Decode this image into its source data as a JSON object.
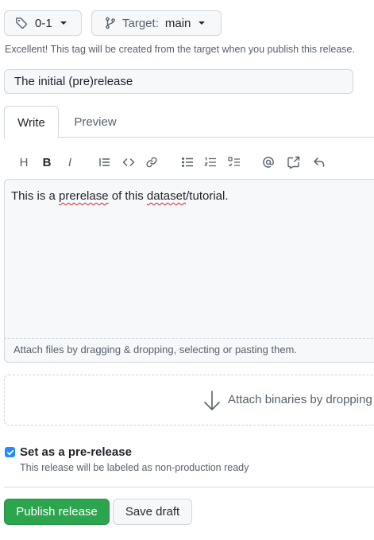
{
  "tag_selector": {
    "value": "0-1",
    "icon": "tag-icon"
  },
  "target_selector": {
    "prefix": "Target:",
    "value": "main",
    "icon": "git-branch-icon"
  },
  "tag_hint": "Excellent! This tag will be created from the target when you publish this release.",
  "release_title": {
    "value": "The initial (pre)release"
  },
  "tabs": [
    {
      "label": "Write",
      "selected": true
    },
    {
      "label": "Preview",
      "selected": false
    }
  ],
  "toolbar": {
    "heading": "H",
    "bold": "B",
    "italic": "I",
    "icons": [
      "heading-icon",
      "bold-icon",
      "italic-icon",
      "quote-icon",
      "code-icon",
      "link-icon",
      "bullet-list-icon",
      "numbered-list-icon",
      "task-list-icon",
      "mention-icon",
      "cross-reference-icon",
      "reply-icon"
    ]
  },
  "editor": {
    "text_before": "This is a ",
    "misspelled_1": "prerelase",
    "text_mid": " of this ",
    "misspelled_2": "dataset",
    "text_after": "/tutorial."
  },
  "attach_files_text": "Attach files by dragging & dropping, selecting or pasting them.",
  "attach_binaries_text": "Attach binaries by dropping",
  "prerelease": {
    "checked": true,
    "label": "Set as a pre-release",
    "note": "This release will be labeled as non-production ready"
  },
  "actions": {
    "publish_label": "Publish release",
    "draft_label": "Save draft"
  },
  "colors": {
    "primary_green": "#2da44e",
    "checkbox_blue": "#218bff",
    "muted_text": "#57606a",
    "border": "#d0d7de"
  }
}
